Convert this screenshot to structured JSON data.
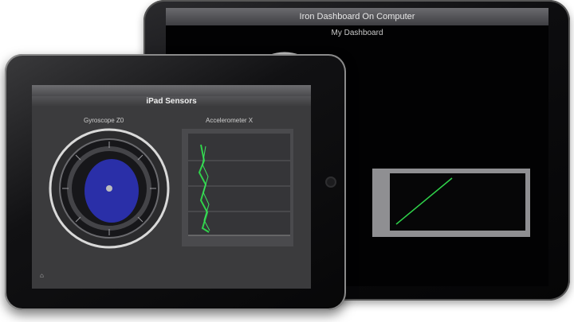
{
  "back_tablet": {
    "title": "Iron Dashboard On Computer",
    "subtitle": "My Dashboard"
  },
  "front_tablet": {
    "subtitle": "iPad Sensors",
    "left_panel_label": "Gyroscope Z0",
    "right_panel_label": "Accelerometer X"
  },
  "icons": {
    "home": "home-icon"
  },
  "colors": {
    "gauge_fill": "#2a2fa8",
    "trace": "#2fd34a",
    "screen_bg": "#020203"
  }
}
